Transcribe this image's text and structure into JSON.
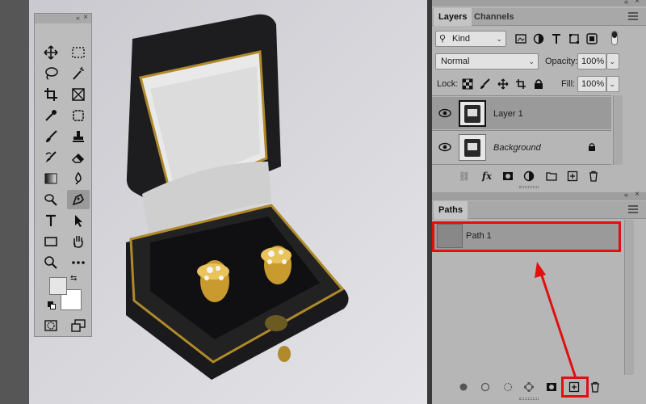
{
  "toolbar": {
    "tools": [
      {
        "name": "move-tool"
      },
      {
        "name": "marquee-tool"
      },
      {
        "name": "lasso-tool"
      },
      {
        "name": "magic-wand-tool"
      },
      {
        "name": "crop-tool"
      },
      {
        "name": "frame-tool"
      },
      {
        "name": "eyedropper-tool"
      },
      {
        "name": "healing-brush-tool"
      },
      {
        "name": "brush-tool"
      },
      {
        "name": "clone-stamp-tool"
      },
      {
        "name": "history-brush-tool"
      },
      {
        "name": "eraser-tool"
      },
      {
        "name": "gradient-tool"
      },
      {
        "name": "blur-tool"
      },
      {
        "name": "dodge-tool"
      },
      {
        "name": "pen-tool",
        "active": true
      },
      {
        "name": "type-tool"
      },
      {
        "name": "path-selection-tool"
      },
      {
        "name": "rectangle-tool"
      },
      {
        "name": "hand-tool"
      },
      {
        "name": "zoom-tool"
      },
      {
        "name": "more-tools"
      }
    ],
    "foreground_color": "#e6e6e6",
    "background_color": "#ffffff"
  },
  "layers_panel": {
    "tabs": [
      "Layers",
      "Channels"
    ],
    "active_tab": "Layers",
    "filter_kind": "Kind",
    "blend_mode": "Normal",
    "opacity_label": "Opacity:",
    "opacity_value": "100%",
    "lock_label": "Lock:",
    "fill_label": "Fill:",
    "fill_value": "100%",
    "layers": [
      {
        "name": "Layer 1",
        "selected": true,
        "italic": false
      },
      {
        "name": "Background",
        "selected": false,
        "italic": true,
        "locked": true
      }
    ],
    "footer_icons": [
      "link-icon",
      "fx-icon",
      "mask-icon",
      "adjustment-icon",
      "folder-icon",
      "new-layer-icon",
      "trash-icon"
    ]
  },
  "paths_panel": {
    "tabs": [
      "Paths"
    ],
    "active_tab": "Paths",
    "paths": [
      {
        "name": "Path 1",
        "selected": true
      }
    ],
    "footer_icons": [
      "fill-path-icon",
      "stroke-path-icon",
      "selection-path-icon",
      "work-path-icon",
      "mask-path-icon",
      "new-path-icon",
      "trash-icon"
    ]
  },
  "colors": {
    "highlight": "#e01010",
    "panel_bg": "#b6b6b6",
    "selected_row": "#9a9a9a"
  }
}
